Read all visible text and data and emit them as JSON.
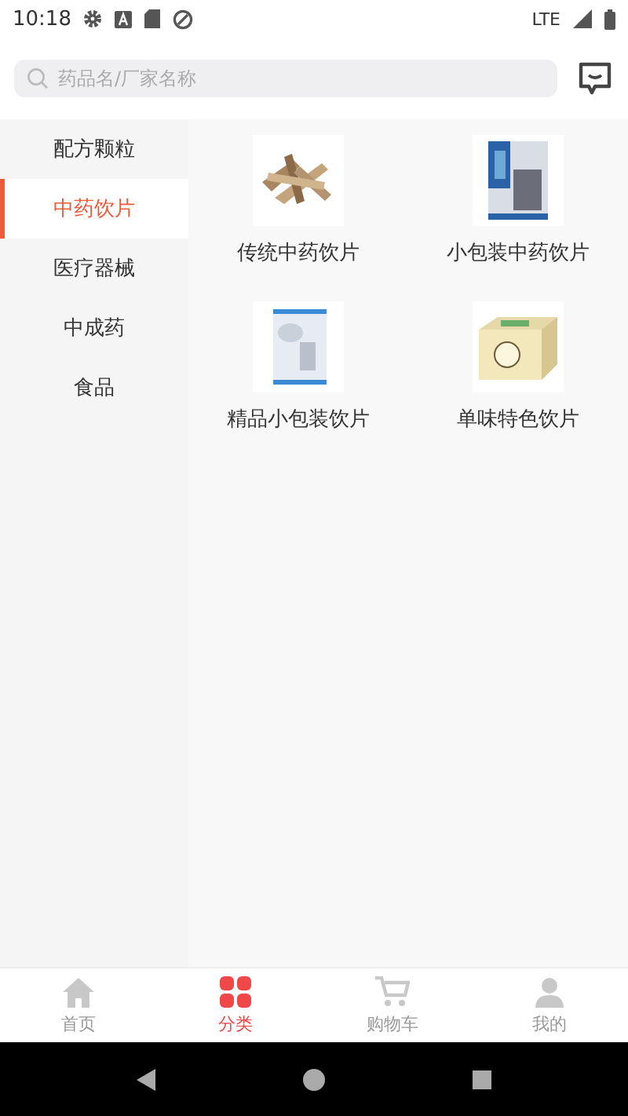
{
  "status_bar": {
    "time": "10:18",
    "network": "LTE"
  },
  "search": {
    "placeholder": "药品名/厂家名称"
  },
  "sidebar": {
    "items": [
      {
        "label": "配方颗粒",
        "selected": false
      },
      {
        "label": "中药饮片",
        "selected": true
      },
      {
        "label": "医疗器械",
        "selected": false
      },
      {
        "label": "中成药",
        "selected": false
      },
      {
        "label": "食品",
        "selected": false
      }
    ]
  },
  "products": [
    {
      "label": "传统中药饮片",
      "kind": "picture"
    },
    {
      "label": "小包装中药饮片",
      "kind": "picture"
    },
    {
      "label": "精品小包装饮片",
      "kind": "picture"
    },
    {
      "label": "单味特色饮片",
      "kind": "picture"
    }
  ],
  "bottom_nav": [
    {
      "label": "首页",
      "kind": "home",
      "selected": false
    },
    {
      "label": "分类",
      "kind": "grid",
      "selected": true
    },
    {
      "label": "购物车",
      "kind": "cart",
      "selected": false
    },
    {
      "label": "我的",
      "kind": "person",
      "selected": false
    }
  ]
}
